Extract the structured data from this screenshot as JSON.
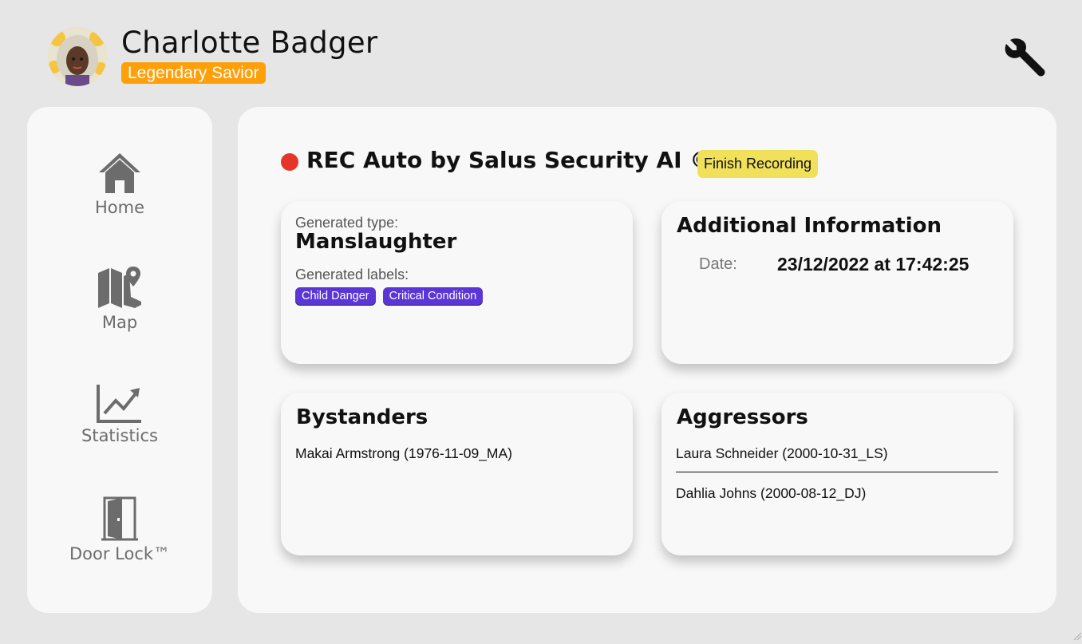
{
  "user": {
    "name": "Charlotte Badger",
    "rank": "Legendary Savior"
  },
  "header": {
    "settings_icon": "wrench-icon"
  },
  "sidebar": {
    "items": [
      {
        "label": "Home",
        "icon": "home-icon"
      },
      {
        "label": "Map",
        "icon": "map-icon"
      },
      {
        "label": "Statistics",
        "icon": "statistics-icon"
      },
      {
        "label": "Door Lock™",
        "icon": "door-icon"
      }
    ]
  },
  "recording": {
    "title": "REC Auto by Salus Security AI ©",
    "finish_label": "Finish Recording",
    "dot_color": "#e53528"
  },
  "generated": {
    "type_label": "Generated type:",
    "type_value": "Manslaughter",
    "labels_label": "Generated labels:",
    "labels": [
      "Child Danger",
      "Critical Condition"
    ]
  },
  "additional": {
    "title": "Additional Information",
    "date_key": "Date:",
    "date_value": "23/12/2022 at 17:42:25"
  },
  "bystanders": {
    "title": "Bystanders",
    "people": [
      "Makai Armstrong (1976-11-09_MA)"
    ]
  },
  "aggressors": {
    "title": "Aggressors",
    "people": [
      "Laura Schneider (2000-10-31_LS)",
      "Dahlia Johns (2000-08-12_DJ)"
    ]
  },
  "colors": {
    "background": "#e6e6e6",
    "panel": "#f8f8f8",
    "badge": "#ff9f0a",
    "tag": "#5b35d5",
    "finish_button": "#f0e05a",
    "nav_icon": "#6c6c6c"
  }
}
